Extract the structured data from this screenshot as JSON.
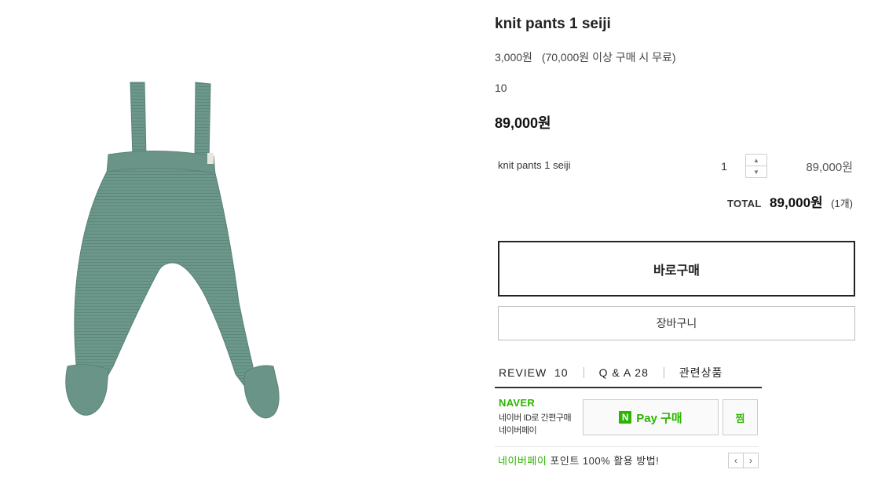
{
  "product": {
    "title": "knit pants 1 seiji",
    "shipping_fee": "3,000원",
    "shipping_note": "(70,000원 이상 구매 시 무료)",
    "quantity_note": "10",
    "price": "89,000원"
  },
  "option": {
    "name": "knit pants 1 seiji",
    "quantity": "1",
    "up_icon": "▲",
    "down_icon": "▼",
    "price": "89,000원"
  },
  "total": {
    "label": "TOTAL",
    "amount": "89,000원",
    "count": "(1개)"
  },
  "buttons": {
    "buy_now": "바로구매",
    "cart": "장바구니"
  },
  "tabs": {
    "review": "REVIEW  10",
    "qna": "Q & A 28",
    "related": "관련상품"
  },
  "naver": {
    "logo": "NAVER",
    "desc_line1": "네이버 ID로 간편구매",
    "desc_line2": "네이버페이",
    "pay_n": "N",
    "pay_label": "Pay 구매",
    "zzim": "찜",
    "promo_green": "네이버페이",
    "promo_rest": " 포인트 100% 활용 방법!",
    "prev_icon": "‹",
    "next_icon": "›"
  },
  "colors": {
    "naver_green": "#2db400",
    "pants_green": "#6e9a8e"
  }
}
